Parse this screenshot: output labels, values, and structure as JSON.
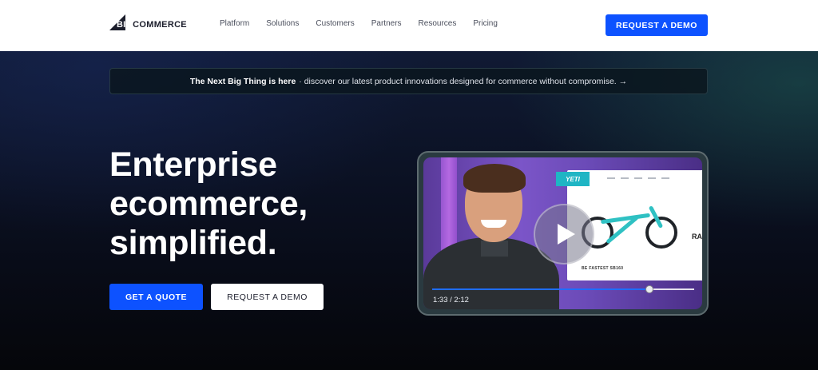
{
  "nav": {
    "logo_big": "BIG",
    "logo_commerce": "COMMERCE",
    "items": [
      "Platform",
      "Solutions",
      "Customers",
      "Partners",
      "Resources",
      "Pricing"
    ],
    "cta_label": "REQUEST A DEMO"
  },
  "announcement": {
    "strong": "The Next Big Thing is here",
    "text": "· discover our latest product innovations designed for commerce without compromise. →"
  },
  "hero": {
    "headline": [
      "Enterprise",
      "ecommerce,",
      "simplified."
    ],
    "primary_button": "GET A QUOTE",
    "secondary_button": "REQUEST A DEMO"
  },
  "video": {
    "site_logo": "YETI",
    "site_caption": "BE FASTEST SB160",
    "site_partial_text": "RA",
    "current_time": "1:33",
    "duration": "2:12",
    "time_display": "1:33 / 2:12",
    "progress": 0.83
  },
  "colors": {
    "accent": "#0d52ff",
    "nav_background": "#ffffff",
    "hero_background": "#0a0f1f"
  }
}
